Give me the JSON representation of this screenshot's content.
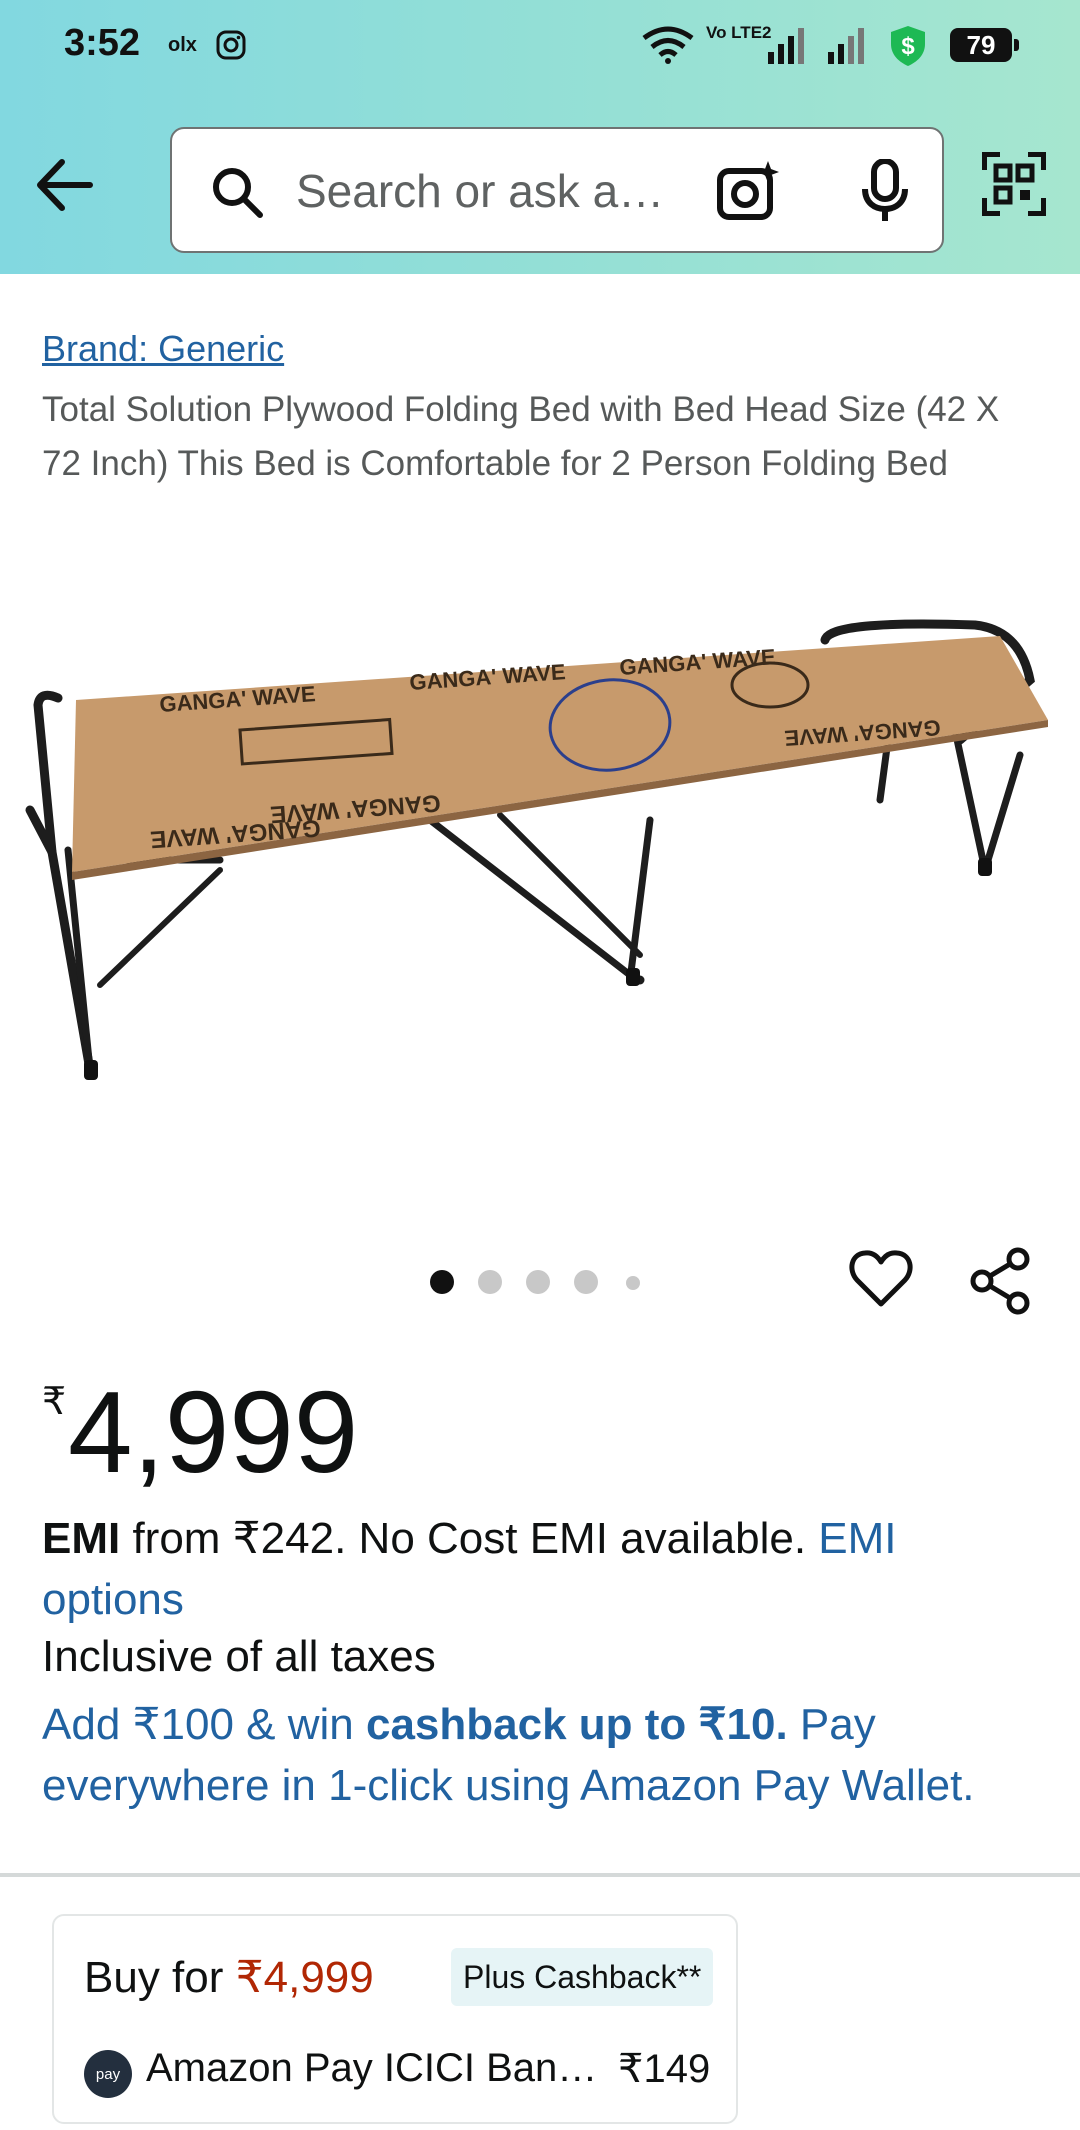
{
  "status_bar": {
    "time": "3:52",
    "network": "Vo LTE2",
    "battery": "79"
  },
  "search": {
    "placeholder": "Search or ask a…"
  },
  "product": {
    "brand": "Brand: Generic",
    "title": "Total Solution Plywood Folding Bed with Bed Head Size (42 X 72 Inch) This Bed is Comfortable for 2 Person Folding Bed",
    "image_labels": [
      "GANGA' WAVE"
    ],
    "carousel": {
      "total": 5,
      "active_index": 0
    }
  },
  "price": {
    "currency": "₹",
    "amount": "4,999"
  },
  "emi": {
    "label": "EMI",
    "text": " from ₹242. No Cost EMI available.  ",
    "link": "EMI options"
  },
  "taxes": "Inclusive of all taxes",
  "promo": {
    "prefix": "Add ₹100 & win ",
    "bold": "cashback up to ₹10.",
    "suffix": " Pay everywhere in 1-click using Amazon Pay Wallet."
  },
  "offer_card": {
    "buy_prefix": "Buy for ",
    "buy_price": "₹4,999",
    "badge": "Plus Cashback**",
    "pay_logo": "pay",
    "bank_name": "Amazon Pay ICICI Ban…",
    "bank_amount": "₹149"
  },
  "colors": {
    "header_gradient_start": "#82d8e0",
    "header_gradient_end": "#a6e6cf",
    "link": "#2162a1",
    "price_red": "#b12704",
    "shield_green": "#1db954"
  },
  "icons": [
    "back-arrow-icon",
    "search-icon",
    "camera-lens-icon",
    "mic-icon",
    "qr-scan-icon",
    "heart-icon",
    "share-icon",
    "wifi-icon",
    "signal-icon",
    "shield-icon",
    "instagram-icon",
    "olx-icon"
  ]
}
